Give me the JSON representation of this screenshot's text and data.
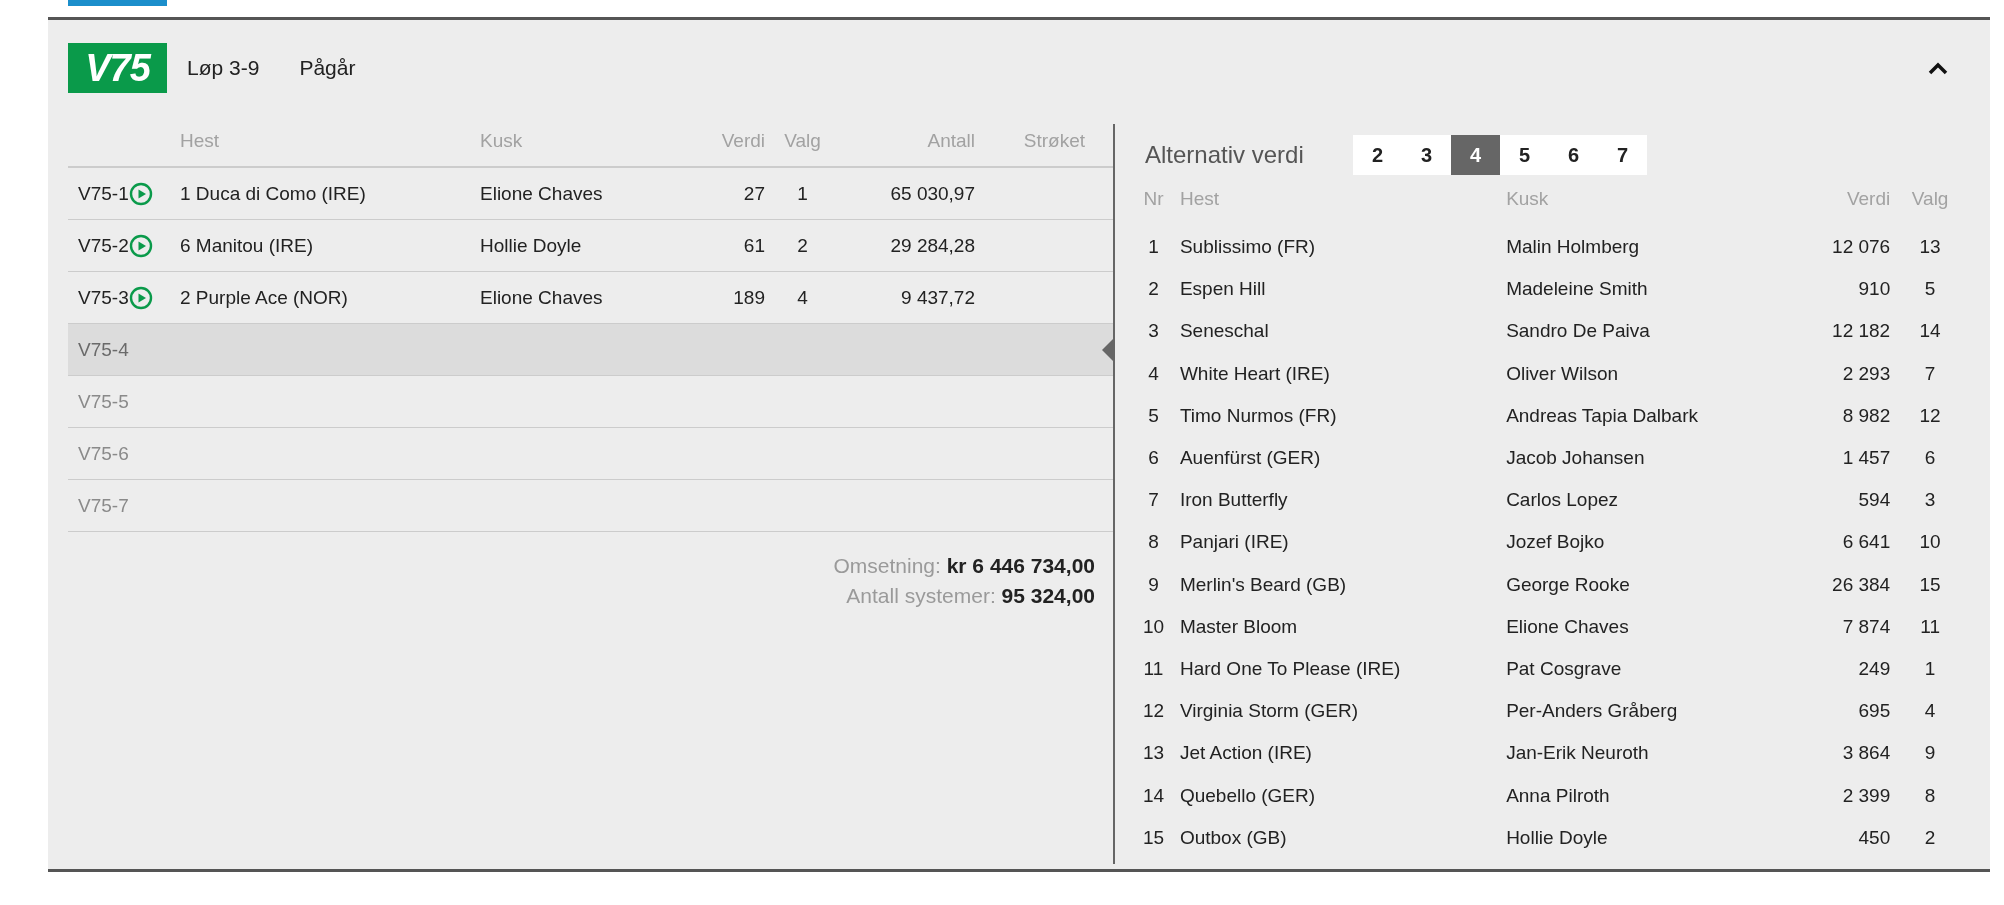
{
  "header": {
    "logo": "V75",
    "race_range": "Løp 3-9",
    "status": "Pågår",
    "expanded": true
  },
  "legs_table": {
    "columns": [
      "Hest",
      "Kusk",
      "Verdi",
      "Valg",
      "Antall",
      "Strøket"
    ],
    "rows": [
      {
        "kind": "result",
        "leg": "V75-1",
        "horse": "1 Duca di Como (IRE)",
        "driver": "Elione Chaves",
        "value": "27",
        "choice": "1",
        "count": "65 030,97",
        "selected": false
      },
      {
        "kind": "result",
        "leg": "V75-2",
        "horse": "6 Manitou (IRE)",
        "driver": "Hollie Doyle",
        "value": "61",
        "choice": "2",
        "count": "29 284,28",
        "selected": false
      },
      {
        "kind": "result",
        "leg": "V75-3",
        "horse": "2 Purple Ace (NOR)",
        "driver": "Elione Chaves",
        "value": "189",
        "choice": "4",
        "count": "9 437,72",
        "selected": false
      },
      {
        "kind": "pending",
        "leg": "V75-4",
        "selected": true
      },
      {
        "kind": "pending",
        "leg": "V75-5",
        "selected": false
      },
      {
        "kind": "pending",
        "leg": "V75-6",
        "selected": false
      },
      {
        "kind": "pending",
        "leg": "V75-7",
        "selected": false
      }
    ]
  },
  "totals": [
    "Omsetning: **kr 6 446 734,00**",
    "Antall systemer: **95 324,00**"
  ],
  "alternatives": {
    "title": "Alternativ verdi",
    "tabs": [
      {
        "label": "2",
        "selected": false
      },
      {
        "label": "3",
        "selected": false
      },
      {
        "label": "4",
        "selected": true
      },
      {
        "label": "5",
        "selected": false
      },
      {
        "label": "6",
        "selected": false
      },
      {
        "label": "7",
        "selected": false
      }
    ],
    "columns": [
      "Nr",
      "Hest",
      "Kusk",
      "Verdi",
      "Valg"
    ],
    "rows": [
      [
        "1",
        "Sublissimo (FR)",
        "Malin Holmberg",
        "12 076",
        "13"
      ],
      [
        "2",
        "Espen Hill",
        "Madeleine Smith",
        "910",
        "5"
      ],
      [
        "3",
        "Seneschal",
        "Sandro De Paiva",
        "12 182",
        "14"
      ],
      [
        "4",
        "White Heart (IRE)",
        "Oliver Wilson",
        "2 293",
        "7"
      ],
      [
        "5",
        "Timo Nurmos (FR)",
        "Andreas Tapia Dalbark",
        "8 982",
        "12"
      ],
      [
        "6",
        "Auenfürst (GER)",
        "Jacob Johansen",
        "1 457",
        "6"
      ],
      [
        "7",
        "Iron Butterfly",
        "Carlos Lopez",
        "594",
        "3"
      ],
      [
        "8",
        "Panjari (IRE)",
        "Jozef Bojko",
        "6 641",
        "10"
      ],
      [
        "9",
        "Merlin's Beard (GB)",
        "George Rooke",
        "26 384",
        "15"
      ],
      [
        "10",
        "Master Bloom",
        "Elione Chaves",
        "7 874",
        "11"
      ],
      [
        "11",
        "Hard One To Please (IRE)",
        "Pat Cosgrave",
        "249",
        "1"
      ],
      [
        "12",
        "Virginia Storm (GER)",
        "Per-Anders Gråberg",
        "695",
        "4"
      ],
      [
        "13",
        "Jet Action (IRE)",
        "Jan-Erik Neuroth",
        "3 864",
        "9"
      ],
      [
        "14",
        "Quebello (GER)",
        "Anna Pilroth",
        "2 399",
        "8"
      ],
      [
        "15",
        "Outbox (GB)",
        "Hollie Doyle",
        "450",
        "2"
      ]
    ]
  }
}
